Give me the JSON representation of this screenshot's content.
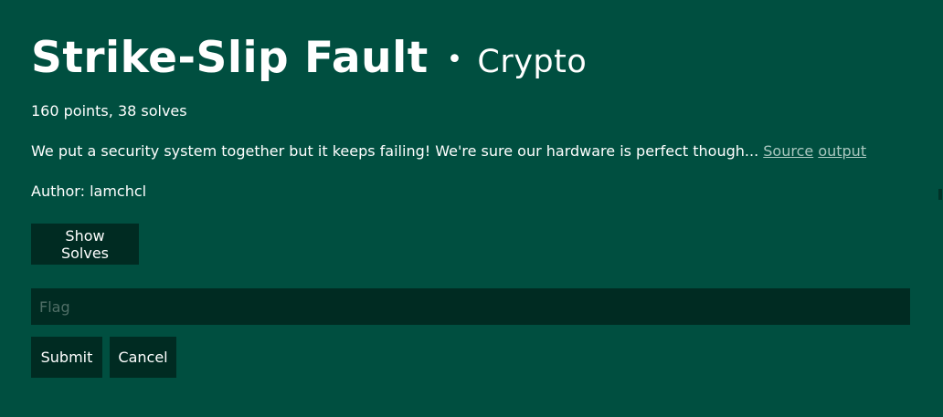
{
  "challenge": {
    "title": "Strike-Slip Fault",
    "separator": "•",
    "category": "Crypto",
    "stats": "160 points, 38 solves",
    "description": "We put a security system together but it keeps failing! We're sure our hardware is perfect though...",
    "links": [
      {
        "label": "Source"
      },
      {
        "label": "output"
      }
    ],
    "author": "Author: lamchcl"
  },
  "actions": {
    "show_solves_label": "Show Solves",
    "flag_placeholder": "Flag",
    "flag_value": "",
    "submit_label": "Submit",
    "cancel_label": "Cancel"
  },
  "colors": {
    "background": "#004f40",
    "button": "#002b22",
    "link": "#a9c7bf",
    "text": "#ffffff"
  }
}
